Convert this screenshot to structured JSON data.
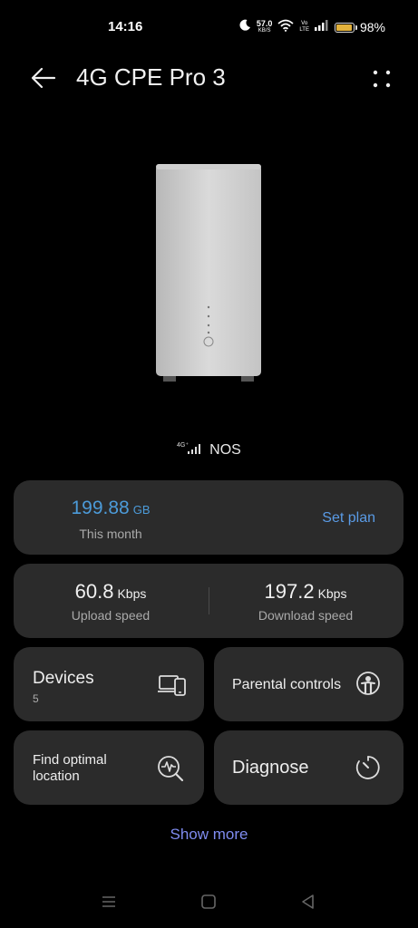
{
  "status_bar": {
    "time": "14:16",
    "net_speed_value": "57.0",
    "net_speed_unit": "KB/S",
    "volte_top": "Vo",
    "volte_bottom": "LTE",
    "battery_percent": "98%",
    "battery_level": 0.98,
    "battery_color": "#e3b23c",
    "icons": [
      "moon-icon",
      "wifi-icon",
      "signal-icon",
      "battery-icon"
    ]
  },
  "header": {
    "title": "4G CPE Pro 3"
  },
  "network": {
    "badge": "4G⁺",
    "operator": "NOS"
  },
  "plan": {
    "value": "199.88",
    "unit": "GB",
    "period": "This month",
    "action": "Set plan"
  },
  "speed": {
    "upload_value": "60.8",
    "upload_unit": "Kbps",
    "upload_label": "Upload speed",
    "download_value": "197.2",
    "download_unit": "Kbps",
    "download_label": "Download speed"
  },
  "tiles": {
    "devices_label": "Devices",
    "devices_count": "5",
    "parental_label": "Parental controls",
    "location_label": "Find optimal location",
    "diagnose_label": "Diagnose"
  },
  "show_more": "Show more",
  "colors": {
    "accent_blue": "#4c9bd9",
    "link_blue": "#5a9be6",
    "show_more": "#7f8cf0",
    "card_bg": "#2b2b2b"
  }
}
